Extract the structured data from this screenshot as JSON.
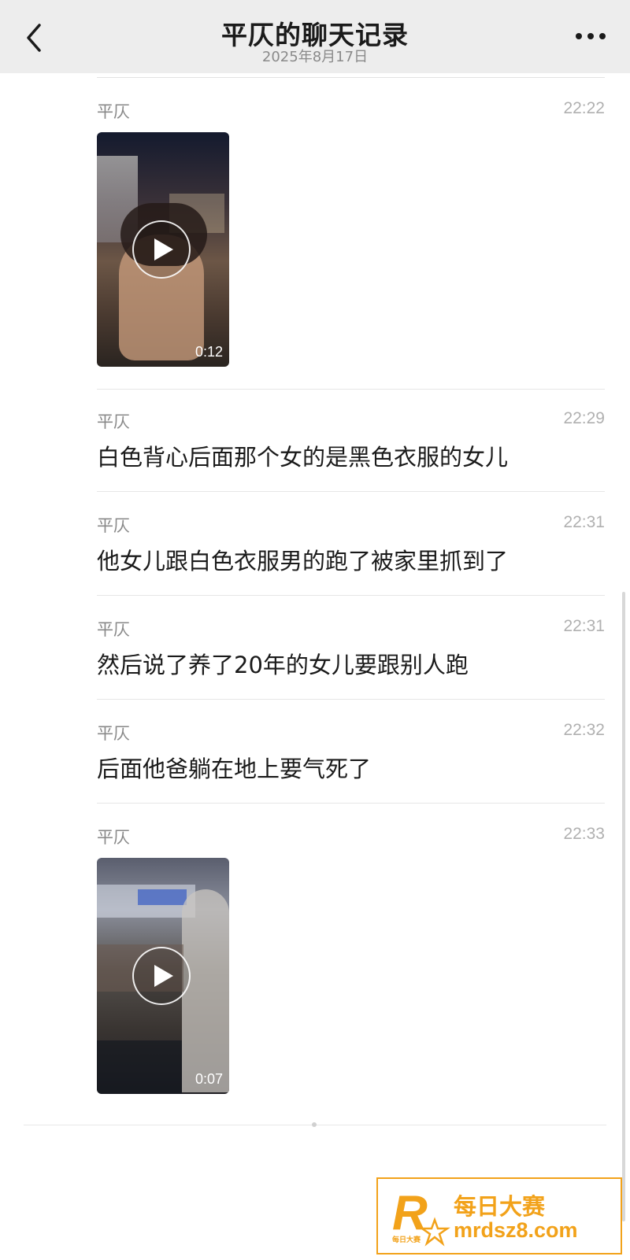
{
  "header": {
    "title": "平仄的聊天记录",
    "date": "2025年8月17日"
  },
  "messages": [
    {
      "sender": "平仄",
      "time": "22:22",
      "type": "video",
      "duration": "0:12"
    },
    {
      "sender": "平仄",
      "time": "22:29",
      "type": "text",
      "text": "白色背心后面那个女的是黑色衣服的女儿"
    },
    {
      "sender": "平仄",
      "time": "22:31",
      "type": "text",
      "text": "他女儿跟白色衣服男的跑了被家里抓到了"
    },
    {
      "sender": "平仄",
      "time": "22:31",
      "type": "text",
      "text": "然后说了养了20年的女儿要跟别人跑"
    },
    {
      "sender": "平仄",
      "time": "22:32",
      "type": "text",
      "text": "后面他爸躺在地上要气死了"
    },
    {
      "sender": "平仄",
      "time": "22:33",
      "type": "video",
      "duration": "0:07"
    }
  ],
  "watermark": {
    "logo_letter": "R",
    "logo_small": "每日大赛",
    "brand": "每日大赛",
    "url": "mrdsz8.com"
  },
  "colors": {
    "accent": "#f2a21a",
    "header_bg": "#ededed"
  },
  "icons": [
    "back-chevron-icon",
    "more-dots-icon",
    "play-icon"
  ]
}
